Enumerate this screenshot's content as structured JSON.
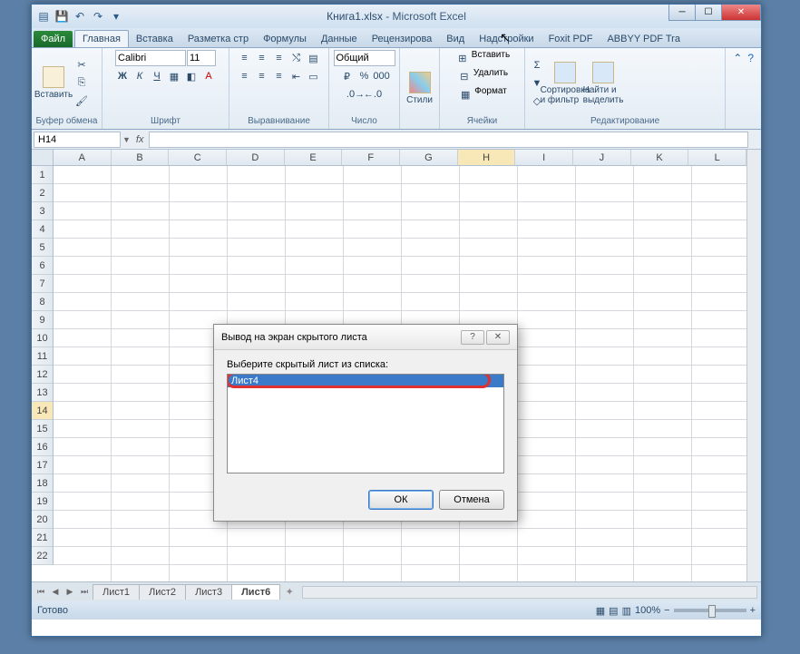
{
  "title": {
    "filename": "Книга1.xlsx",
    "app": "Microsoft Excel"
  },
  "ribbon": {
    "tabs": {
      "file": "Файл",
      "home": "Главная",
      "insert": "Вставка",
      "layout": "Разметка стр",
      "formulas": "Формулы",
      "data": "Данные",
      "review": "Рецензирова",
      "view": "Вид",
      "addins": "Надстройки",
      "foxit": "Foxit PDF",
      "abbyy": "ABBYY PDF Tra"
    },
    "groups": {
      "clipboard": {
        "label": "Буфер обмена",
        "paste": "Вставить"
      },
      "font": {
        "label": "Шрифт",
        "name": "Calibri",
        "size": "11"
      },
      "align": {
        "label": "Выравнивание"
      },
      "number": {
        "label": "Число",
        "format": "Общий"
      },
      "styles": {
        "label": "Стили",
        "btn": "Стили"
      },
      "cells": {
        "label": "Ячейки",
        "insert": "Вставить",
        "delete": "Удалить",
        "format": "Формат"
      },
      "editing": {
        "label": "Редактирование",
        "sort": "Сортировка и фильтр",
        "find": "Найти и выделить"
      }
    }
  },
  "formula": {
    "name": "H14",
    "fx": "fx"
  },
  "grid": {
    "cols": [
      "A",
      "B",
      "C",
      "D",
      "E",
      "F",
      "G",
      "H",
      "I",
      "J",
      "K",
      "L"
    ],
    "rows_visible": 22,
    "active_col": "H",
    "active_row": 14
  },
  "sheets": {
    "tabs": [
      "Лист1",
      "Лист2",
      "Лист3",
      "Лист6"
    ],
    "active": "Лист6"
  },
  "status": {
    "ready": "Готово",
    "zoom": "100%"
  },
  "dialog": {
    "title": "Вывод на экран скрытого листа",
    "label": "Выберите скрытый лист из списка:",
    "items": [
      "Лист4"
    ],
    "ok": "ОК",
    "cancel": "Отмена"
  }
}
